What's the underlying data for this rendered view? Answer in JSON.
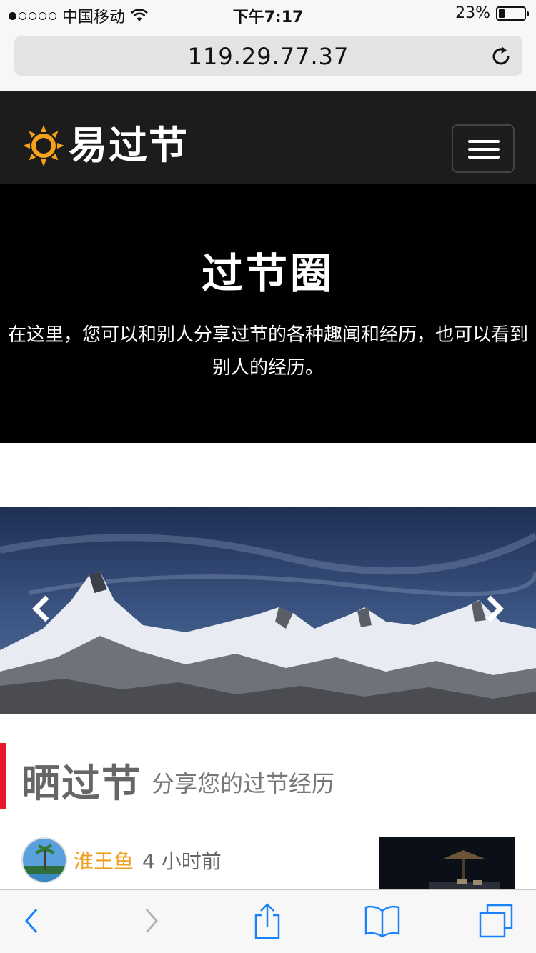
{
  "status_bar": {
    "carrier": "中国移动",
    "time": "下午7:17",
    "battery_percent": "23%",
    "battery_level": 0.23,
    "signal_bars_filled": 1,
    "signal_bars_total": 5
  },
  "browser": {
    "url": "119.29.77.37"
  },
  "header": {
    "logo_text": "易过节",
    "logo_icon": "sun-icon",
    "menu_icon": "hamburger-icon"
  },
  "hero": {
    "title": "过节圈",
    "description": "在这里，您可以和别人分享过节的各种趣闻和经历，也可以看到别人的经历。"
  },
  "carousel": {
    "prev_icon": "chevron-left-icon",
    "next_icon": "chevron-right-icon"
  },
  "section": {
    "title": "晒过节",
    "subtitle": "分享您的过节经历",
    "accent_color": "#e8192c"
  },
  "posts": [
    {
      "author": "淮王鱼",
      "time": "4 小时前"
    }
  ],
  "toolbar": {
    "icons": [
      "back-icon",
      "forward-icon",
      "share-icon",
      "bookmarks-icon",
      "tabs-icon"
    ]
  },
  "colors": {
    "author": "#f0a020",
    "ios_blue": "#1a82fb",
    "header_bg": "#1c1c1c"
  }
}
